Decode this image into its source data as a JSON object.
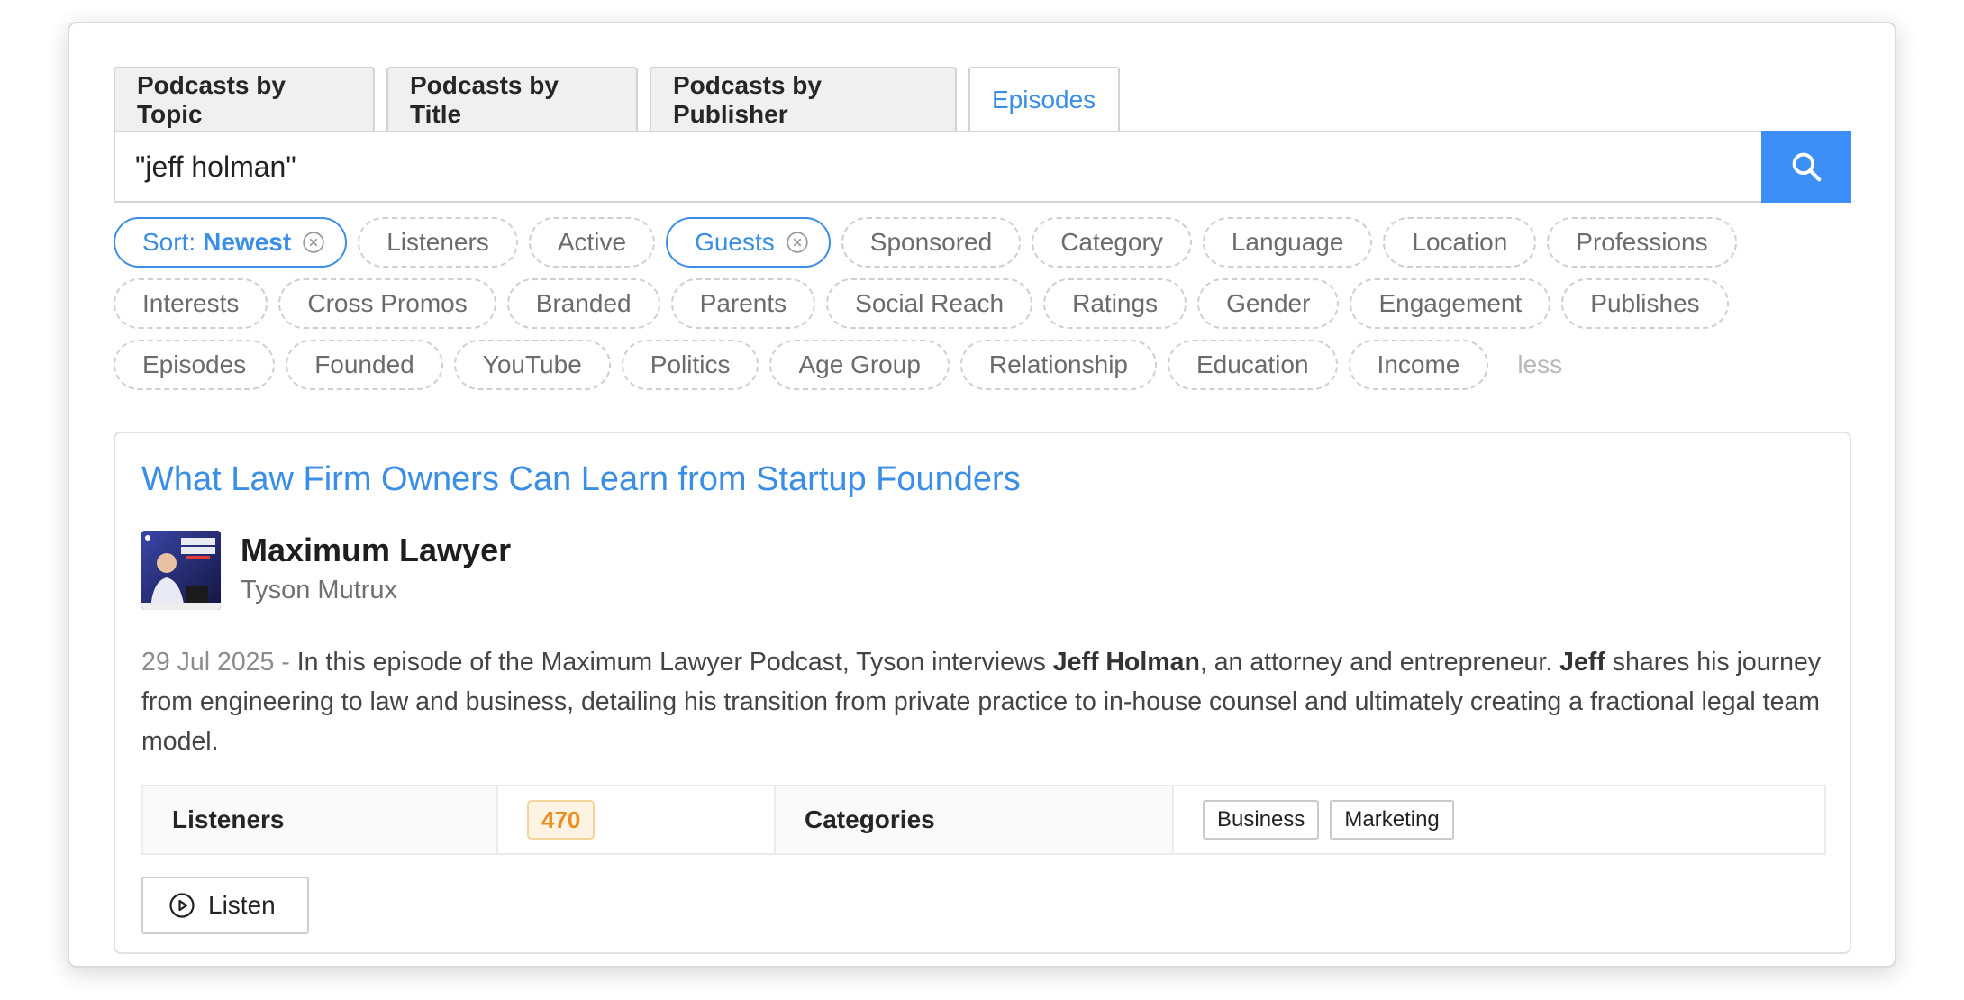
{
  "tabs": [
    {
      "label": "Podcasts by Topic",
      "active": false
    },
    {
      "label": "Podcasts by Title",
      "active": false
    },
    {
      "label": "Podcasts by Publisher",
      "active": false
    },
    {
      "label": "Episodes",
      "active": true
    }
  ],
  "search": {
    "value": "\"jeff holman\"",
    "icon": "search-icon"
  },
  "filters": {
    "sort": {
      "prefix": "Sort:",
      "value": "Newest"
    },
    "guests": {
      "label": "Guests"
    },
    "chips": [
      "Listeners",
      "Active",
      "Sponsored",
      "Category",
      "Language",
      "Location",
      "Professions",
      "Interests",
      "Cross Promos",
      "Branded",
      "Parents",
      "Social Reach",
      "Ratings",
      "Gender",
      "Engagement",
      "Publishes",
      "Episodes",
      "Founded",
      "YouTube",
      "Politics",
      "Age Group",
      "Relationship",
      "Education",
      "Income"
    ],
    "less_label": "less"
  },
  "result": {
    "title": "What Law Firm Owners Can Learn from Startup Founders",
    "podcast_name": "Maximum Lawyer",
    "author": "Tyson Mutrux",
    "date": "29 Jul 2025",
    "separator": "-",
    "desc_part1": "In this episode of the Maximum Lawyer Podcast, Tyson interviews",
    "desc_bold1": "Jeff Holman",
    "desc_part2": ", an attorney and entrepreneur.",
    "desc_bold2": "Jeff",
    "desc_part3": "shares his journey from engineering to law and business, detailing his transition from private practice to in-house counsel and ultimately creating a fractional legal team model.",
    "listeners_label": "Listeners",
    "listeners_value": "470",
    "categories_label": "Categories",
    "categories": [
      "Business",
      "Marketing"
    ],
    "listen_label": "Listen",
    "cover_text": "MAXIMUM LAWYER"
  },
  "colors": {
    "accent": "#3a8ee6",
    "search_button": "#3e8ef7",
    "badge": "#ea8f1e"
  }
}
